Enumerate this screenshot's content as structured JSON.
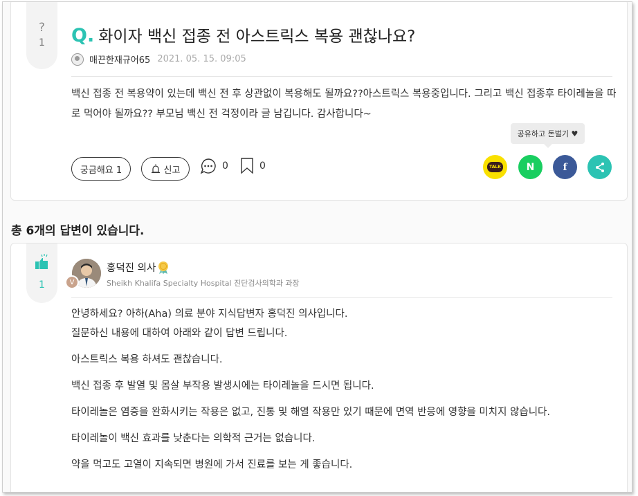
{
  "question": {
    "side_mark": "?",
    "side_count": "1",
    "q_letter": "Q.",
    "title": "화이자 백신 접종 전 아스트릭스 복용 괜찮나요?",
    "author": "매끈한재규어65",
    "date": "2021. 05. 15. 09:05",
    "body": "백신 접종 전 복용약이 있는데 백신 전 후 상관없이 복용해도 될까요??아스트릭스 복용중입니다. 그리고 백신 접종후 타이레놀을 따로 먹어야 될까요?? 부모님 백신 전 걱정이라 글 남깁니다. 감사합니다~",
    "curious_label": "궁금해요 1",
    "report_label": "신고",
    "comment_count": "0",
    "bookmark_count": "0",
    "tooltip": "공유하고 돈벌기 ♥",
    "share": {
      "kakao_label": "TALK",
      "naver_label": "N",
      "facebook_label": "f",
      "colors": {
        "kakao": "#f9e000",
        "naver": "#19ce60",
        "facebook": "#3b5998",
        "share": "#2cc3b3"
      }
    }
  },
  "answers_heading": "총 6개의 답변이 있습니다.",
  "answer": {
    "like_count": "1",
    "doctor_name": "홍덕진 의사",
    "affiliation": "Sheikh Khalifa Specialty Hospital 진단검사의학과 과장",
    "badge_text": "V",
    "paragraphs": [
      "안녕하세요? 아하(Aha) 의료 분야 지식답변자 홍덕진 의사입니다.",
      "질문하신 내용에 대하여 아래와 같이 답변 드립니다.",
      "아스트릭스 복용 하셔도 괜찮습니다.",
      "백신 접종 후 발열 및 몸살 부작용 발생시에는 타이레놀을 드시면 됩니다.",
      "타이레놀은 염증을 완화시키는 작용은 없고, 진통 및 해열 작용만 있기 때문에 면역 반응에 영향을 미치지 않습니다.",
      "타이레놀이 백신 효과를 낮춘다는 의학적 근거는 없습니다.",
      "약을 먹고도 고열이 지속되면 병원에 가서 진료를 보는 게 좋습니다."
    ]
  },
  "colors": {
    "accent": "#2cc3b3"
  }
}
